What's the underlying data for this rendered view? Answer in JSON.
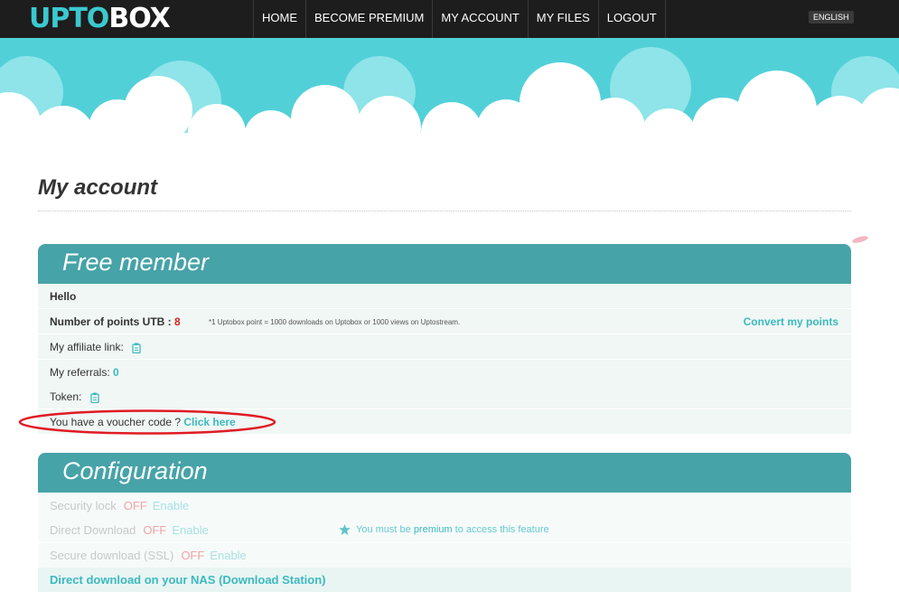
{
  "header": {
    "logo_up": "UPTO",
    "logo_box": "BOX",
    "nav": [
      "HOME",
      "BECOME PREMIUM",
      "MY ACCOUNT",
      "MY FILES",
      "LOGOUT"
    ],
    "language": "ENGLISH"
  },
  "page": {
    "title": "My account"
  },
  "free_member": {
    "heading": "Free member",
    "hello": "Hello",
    "points_label": "Number of points UTB :",
    "points_value": "8",
    "points_note": "*1 Uptobox point = 1000 downloads on Uptobox or 1000 views on Uptostream.",
    "convert_link": "Convert my points",
    "affiliate_label": "My affiliate link:",
    "referrals_label": "My referrals:",
    "referrals_value": "0",
    "token_label": "Token:",
    "voucher_text": "You have a voucher code ?",
    "voucher_link": "Click here"
  },
  "configuration": {
    "heading": "Configuration",
    "security_lock": {
      "label": "Security lock",
      "status": "OFF",
      "action": "Enable"
    },
    "direct_download": {
      "label": "Direct Download",
      "status": "OFF",
      "action": "Enable"
    },
    "secure_download": {
      "label": "Secure download (SSL)",
      "status": "OFF",
      "action": "Enable"
    },
    "premium_note_prefix": "You must be",
    "premium_note_link": "premium",
    "premium_note_suffix": "to access this feature",
    "nas_link": "Direct download on your NAS (Download Station)"
  },
  "colors": {
    "topbar": "#1d1d1d",
    "accent": "#3cb9c0",
    "panel_header": "#46a3a8",
    "row_bg": "#f0f7f5",
    "off_red": "#f3a2a2",
    "highlight_ellipse": "#e01b24"
  },
  "icons": [
    "clipboard-icon",
    "star-icon",
    "cloud-banner"
  ]
}
